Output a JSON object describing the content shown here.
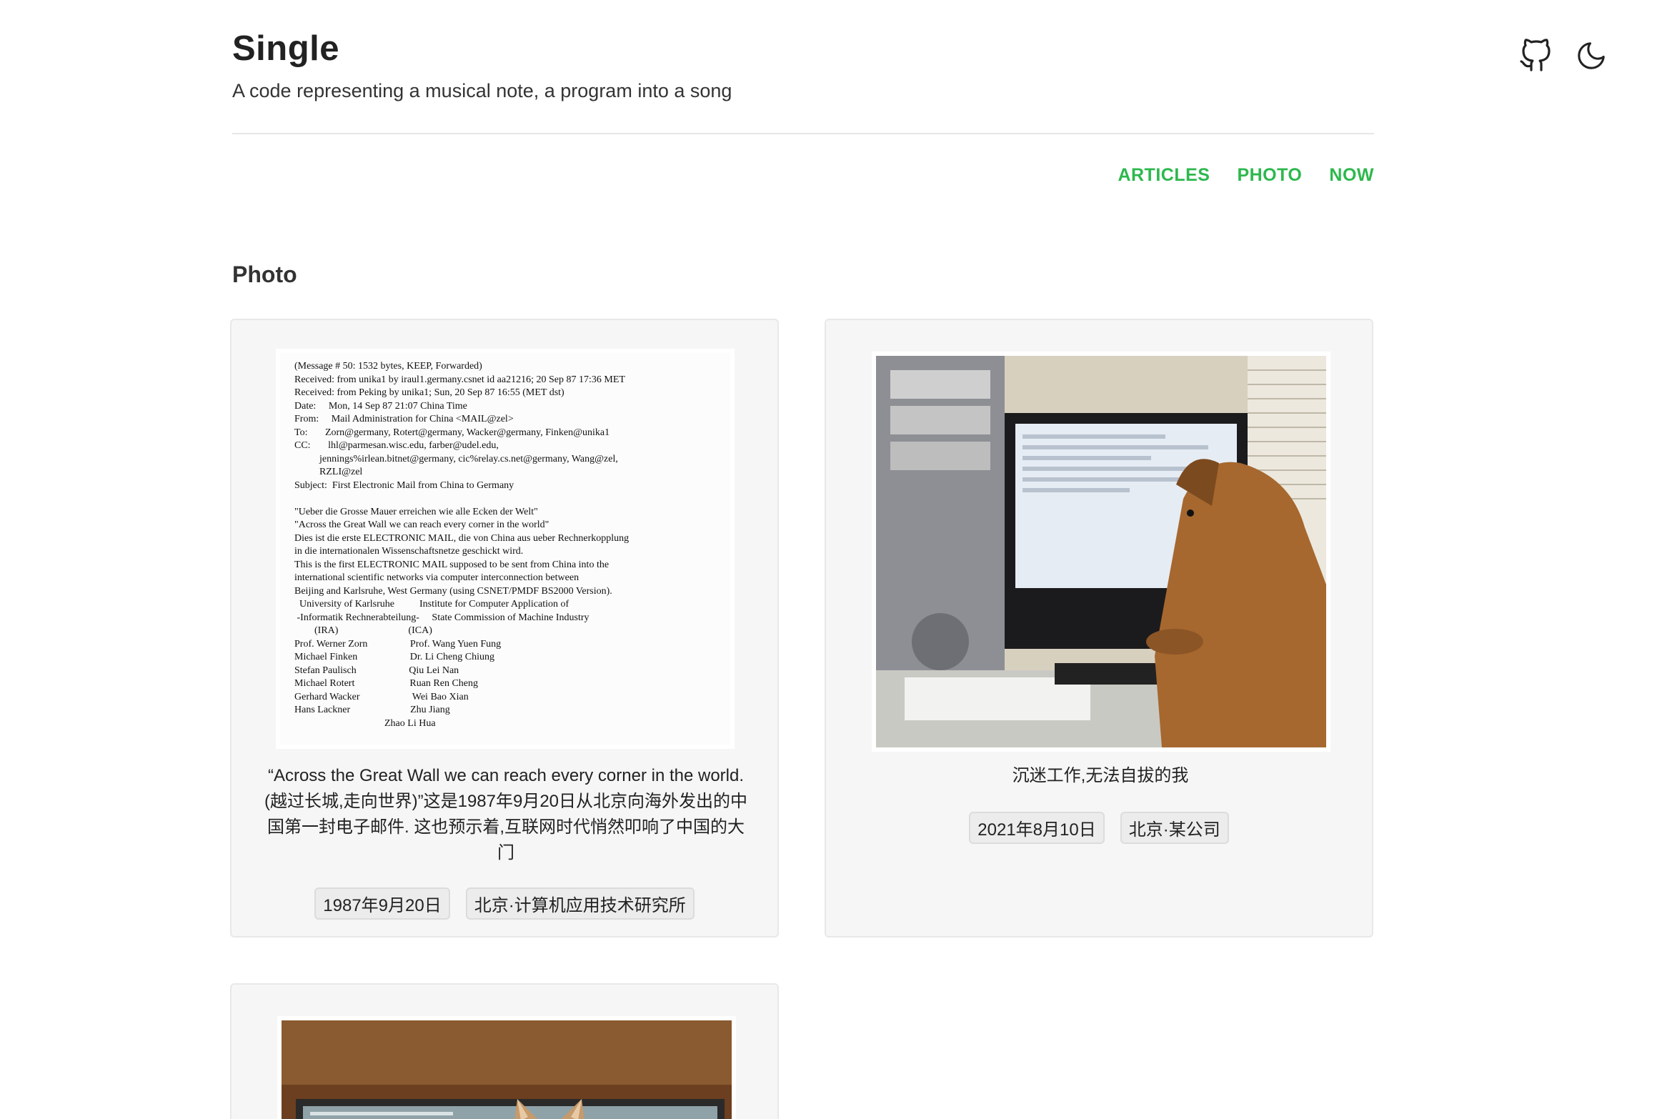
{
  "site": {
    "title": "Single",
    "subtitle": "A code representing a musical note, a program into a song"
  },
  "header_icons": [
    "github-icon",
    "moon-icon"
  ],
  "nav": {
    "articles": "ARTICLES",
    "photo": "PHOTO",
    "now": "NOW"
  },
  "section": {
    "title": "Photo"
  },
  "photos": [
    {
      "caption": "“Across the Great Wall we can reach every corner in the world. (越过长城,走向世界)”这是1987年9月20日从北京向海外发出的中国第一封电子邮件. 这也预示着,互联网时代悄然叩响了中国的大门",
      "date": "1987年9月20日",
      "location": "北京·计算机应用技术研究所",
      "document_text": "(Message # 50: 1532 bytes, KEEP, Forwarded)\nReceived: from unika1 by iraul1.germany.csnet id aa21216; 20 Sep 87 17:36 MET\nReceived: from Peking by unika1; Sun, 20 Sep 87 16:55 (MET dst)\nDate:     Mon, 14 Sep 87 21:07 China Time\nFrom:     Mail Administration for China <MAIL@zel>\nTo:       Zorn@germany, Rotert@germany, Wacker@germany, Finken@unika1\nCC:       lhl@parmesan.wisc.edu, farber@udel.edu,\n          jennings%irlean.bitnet@germany, cic%relay.cs.net@germany, Wang@zel,\n          RZLI@zel\nSubject:  First Electronic Mail from China to Germany\n\n\"Ueber die Grosse Mauer erreichen wie alle Ecken der Welt\"\n\"Across the Great Wall we can reach every corner in the world\"\nDies ist die erste ELECTRONIC MAIL, die von China aus ueber Rechnerkopplung\nin die internationalen Wissenschaftsnetze geschickt wird.\nThis is the first ELECTRONIC MAIL supposed to be sent from China into the\ninternational scientific networks via computer interconnection between\nBeijing and Karlsruhe, West Germany (using CSNET/PMDF BS2000 Version).\n  University of Karlsruhe          Institute for Computer Application of\n -Informatik Rechnerabteilung-     State Commission of Machine Industry\n        (IRA)                            (ICA)\nProf. Werner Zorn                 Prof. Wang Yuen Fung\nMichael Finken                     Dr. Li Cheng Chiung\nStefan Paulisch                     Qiu Lei Nan\nMichael Rotert                      Ruan Ren Cheng\nGerhard Wacker                     Wei Bao Xian\nHans Lackner                        Zhu Jiang\n                                    Zhao Li Hua"
    },
    {
      "caption": "沉迷工作,无法自拔的我",
      "date": "2021年8月10日",
      "location": "北京·某公司"
    },
    {
      "caption": "",
      "date": "",
      "location": ""
    }
  ],
  "colors": {
    "accent": "#2db84d",
    "card_bg": "#f6f6f6",
    "divider": "#e6e6e6"
  }
}
